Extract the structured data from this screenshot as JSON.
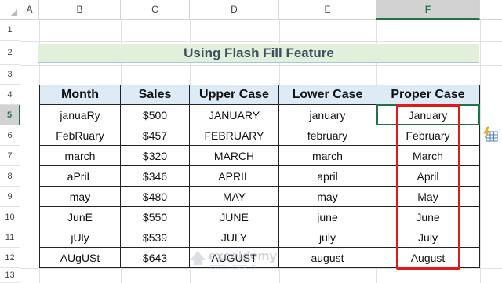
{
  "columns": [
    "A",
    "B",
    "C",
    "D",
    "E",
    "F"
  ],
  "rows": [
    "1",
    "2",
    "3",
    "4",
    "5",
    "6",
    "7",
    "8",
    "9",
    "10",
    "11",
    "12",
    "13"
  ],
  "title": "Using Flash Fill Feature",
  "table": {
    "headers": [
      "Month",
      "Sales",
      "Upper Case",
      "Lower Case",
      "Proper Case"
    ],
    "rows": [
      [
        "januaRy",
        "$500",
        "JANUARY",
        "january",
        "January"
      ],
      [
        "FebRuary",
        "$457",
        "FEBRUARY",
        "february",
        "February"
      ],
      [
        "march",
        "$320",
        "MARCH",
        "march",
        "March"
      ],
      [
        "aPriL",
        "$346",
        "APRIL",
        "april",
        "April"
      ],
      [
        "may",
        "$480",
        "MAY",
        "may",
        "May"
      ],
      [
        "JunE",
        "$550",
        "JUNE",
        "june",
        "June"
      ],
      [
        "jUly",
        "$539",
        "JULY",
        "july",
        "July"
      ],
      [
        "AUgUSt",
        "$643",
        "AUGUST",
        "august",
        "August"
      ]
    ]
  },
  "selection": {
    "column": "F",
    "row": "5"
  },
  "watermark": {
    "brand": "exceldemy",
    "tagline": "EXCEL · DATA · BI"
  },
  "icons": {
    "flash_fill_options": "flash-fill-options-icon",
    "corner": "select-all-triangle-icon"
  },
  "colors": {
    "accent": "#217346",
    "highlight_border": "#e01a1a",
    "header_fill": "#ddebf7",
    "title_fill": "#e2efda"
  }
}
